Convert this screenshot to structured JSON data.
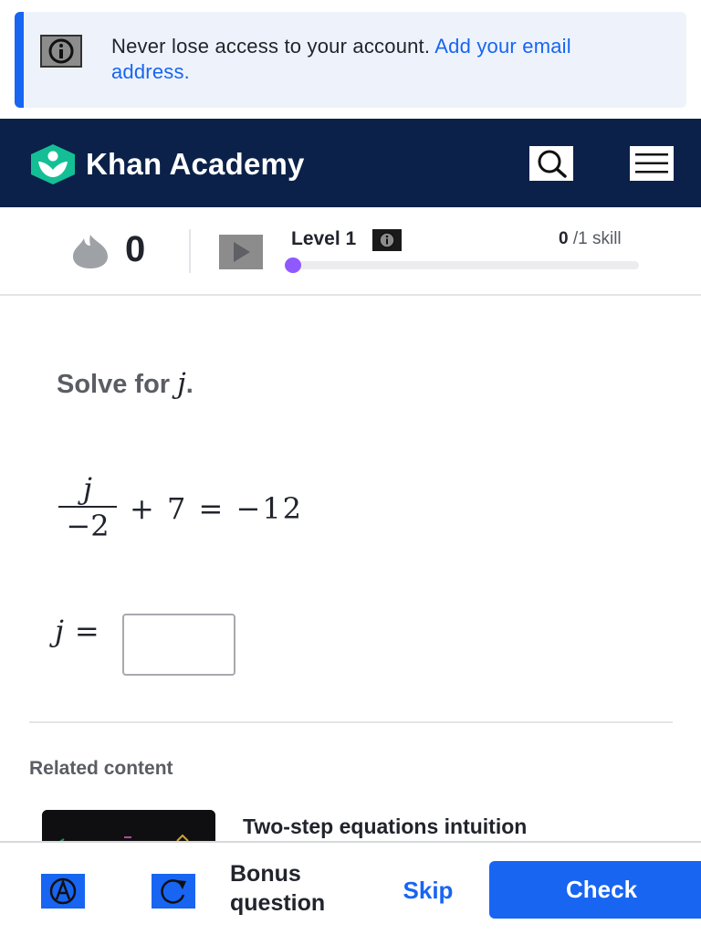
{
  "banner": {
    "message": "Never lose access to your account.",
    "link": "Add your email address.",
    "icon": "info-icon"
  },
  "header": {
    "brand": "Khan Academy",
    "logo_icon": "khan-academy-logo",
    "search_icon": "search-icon",
    "menu_icon": "hamburger-menu-icon",
    "background_color": "#0b2149"
  },
  "progress": {
    "streak_count": "0",
    "streak_icon": "flame-icon",
    "video_icon": "play-icon",
    "level_label": "Level 1",
    "level_info_icon": "info-icon",
    "skills_done": "0",
    "skills_total": "/1 skill",
    "progress_fraction": 0,
    "dot_color": "#9059ff"
  },
  "question": {
    "prompt_text": "Solve for",
    "variable": "j",
    "prompt_end": ".",
    "equation": {
      "numerator": "j",
      "denominator": "−2",
      "rest": "+ 7 = −12"
    },
    "answer": {
      "variable": "j",
      "equals": "=",
      "value": ""
    }
  },
  "related": {
    "heading": "Related content",
    "items": [
      {
        "title": "Two-step equations intuition"
      }
    ]
  },
  "footer": {
    "hint_icon": "hint-icon",
    "retry_icon": "retry-icon",
    "bonus_line1": "Bonus",
    "bonus_line2": "question",
    "skip_label": "Skip",
    "check_label": "Check",
    "accent_color": "#1865f2"
  }
}
